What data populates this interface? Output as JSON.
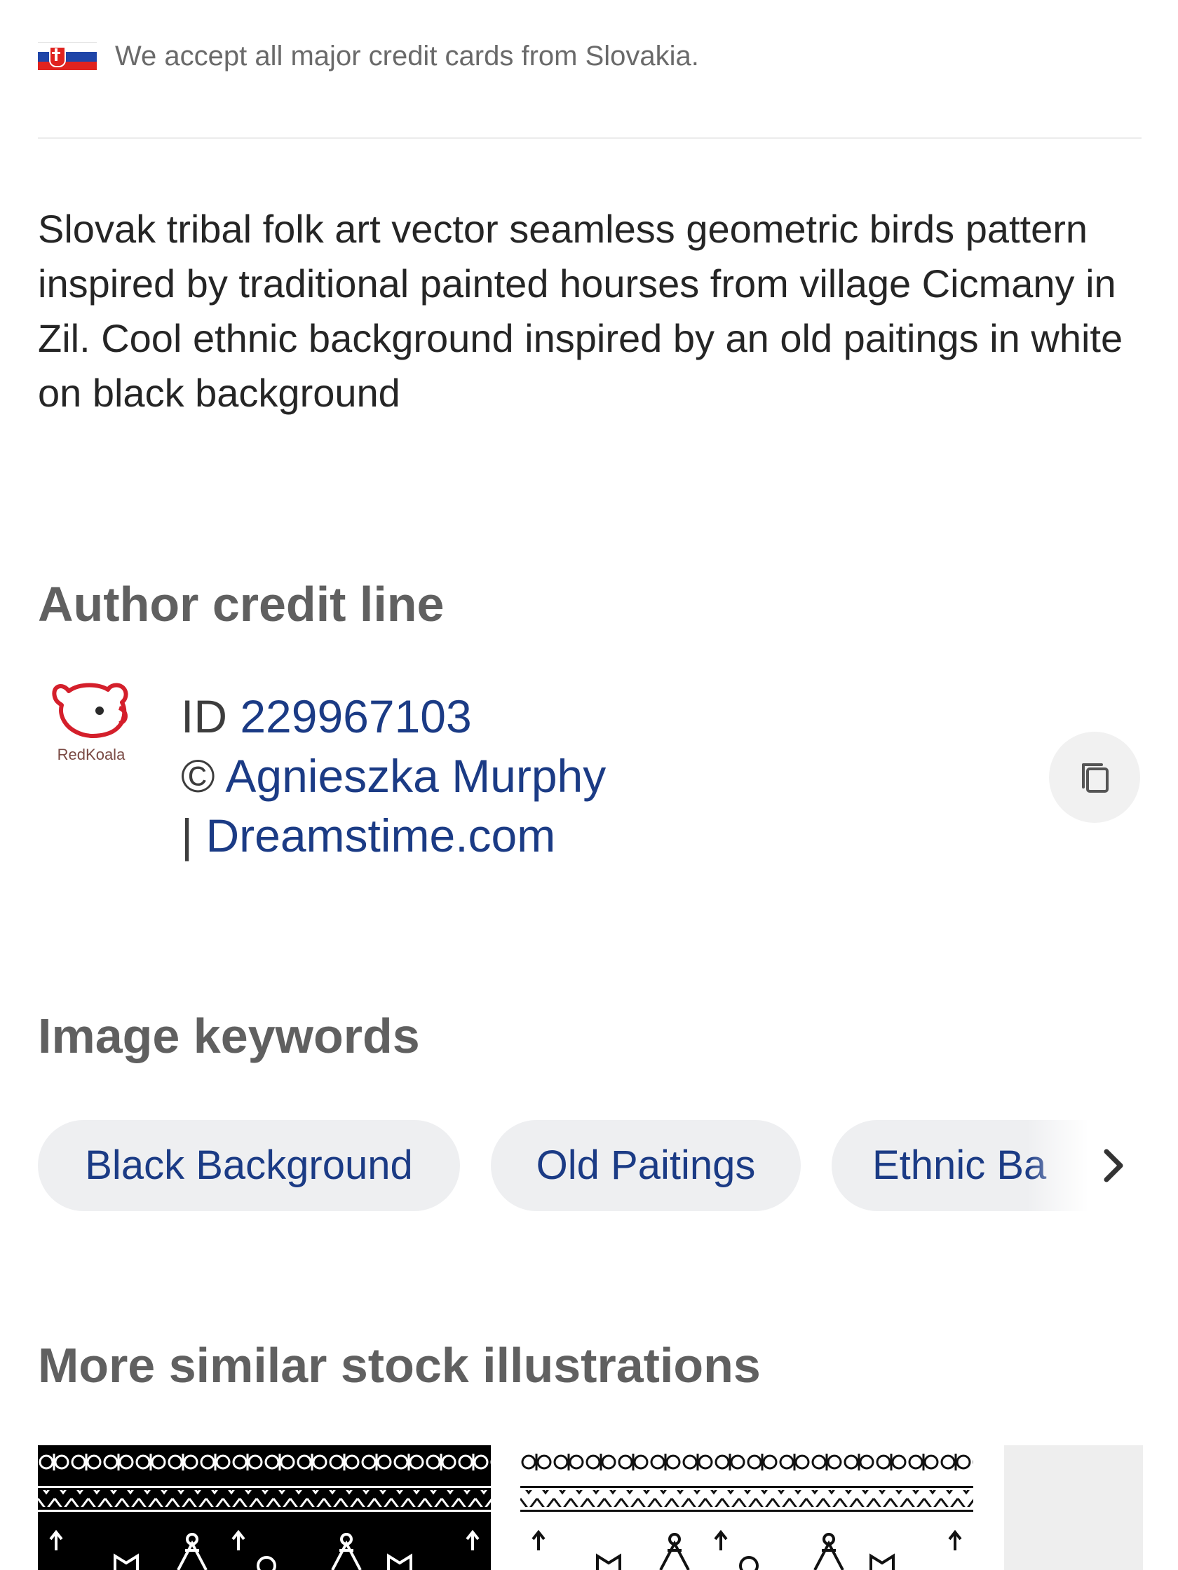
{
  "payment_notice": {
    "flag_icon": "slovakia-flag-icon",
    "text": "We accept all major credit cards from Slovakia."
  },
  "description": "Slovak tribal folk art vector seamless geometric birds pattern inspired by traditional painted hourses from village Cicmany in Zil. Cool ethnic background inspired by an old paitings in white on black background",
  "author_credit": {
    "heading": "Author credit line",
    "logo_text": "RedKoala",
    "id_prefix": "ID",
    "id_value": "229967103",
    "copyright_symbol": "©",
    "author_name": "Agnieszka Murphy",
    "separator": "|",
    "site": "Dreamstime.com",
    "copy_icon": "copy-icon"
  },
  "keywords": {
    "heading": "Image keywords",
    "items": [
      "Black Background",
      "Old Paitings",
      "Ethnic Ba"
    ],
    "next_icon": "chevron-right-icon"
  },
  "similar": {
    "heading": "More similar stock illustrations",
    "thumbnails": [
      {
        "style": "white-on-black"
      },
      {
        "style": "black-on-white"
      },
      {
        "style": "placeholder"
      }
    ]
  },
  "colors": {
    "link": "#1b3b85",
    "heading": "#606060",
    "chip_bg": "#eeeff1"
  }
}
